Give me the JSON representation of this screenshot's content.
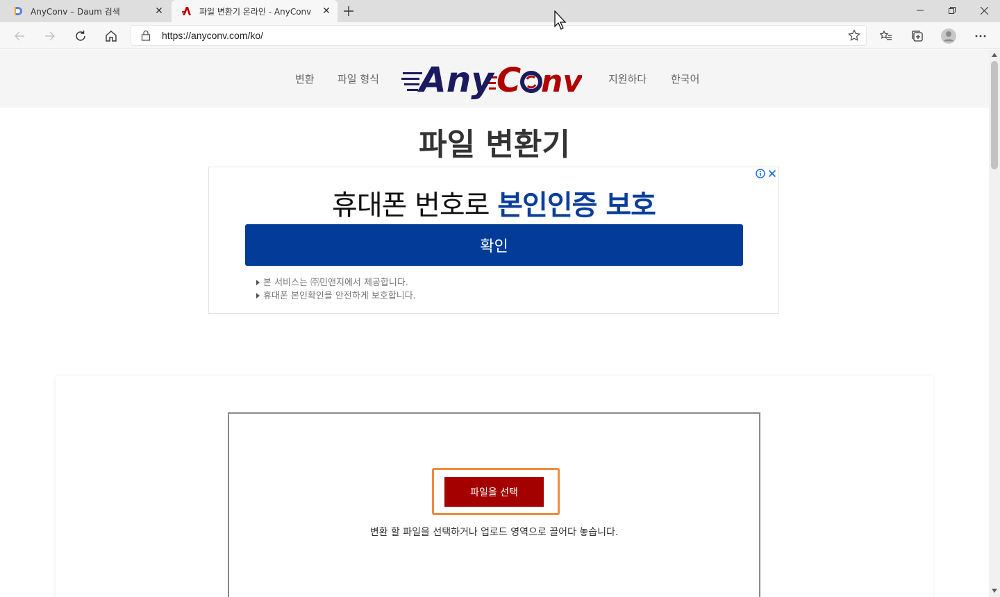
{
  "browser": {
    "tabs": [
      {
        "title": "AnyConv – Daum 검색",
        "favicon": "daum-icon",
        "active": false
      },
      {
        "title": "파일 변환기 온라인 - AnyConv",
        "favicon": "anyconv-icon",
        "active": true
      }
    ],
    "url": "https://anyconv.com/ko/"
  },
  "site_nav": {
    "left": [
      "변환",
      "파일 형식"
    ],
    "right": [
      "지원하다",
      "한국어"
    ],
    "logo": {
      "text_any": "Any",
      "text_c": "C",
      "text_nv": "nv",
      "colors": {
        "navy": "#1c1a5e",
        "red": "#b00000"
      }
    }
  },
  "main": {
    "title": "파일 변환기"
  },
  "ad": {
    "headline_plain": "휴대폰 번호로 ",
    "headline_bold": "본인인증 보호",
    "button": "확인",
    "notes": [
      "본 서비스는 ㈜민앤지에서 제공합니다.",
      "휴대폰 본인확인을 안전하게 보호합니다."
    ],
    "accent_color": "#033c98"
  },
  "upload": {
    "choose_button": "파일을 선택",
    "hint": "변환 할 파일을 선택하거나 업로드 영역으로 끌어다 놓습니다.",
    "button_color": "#a40000",
    "outline_color": "#f28a3c"
  }
}
